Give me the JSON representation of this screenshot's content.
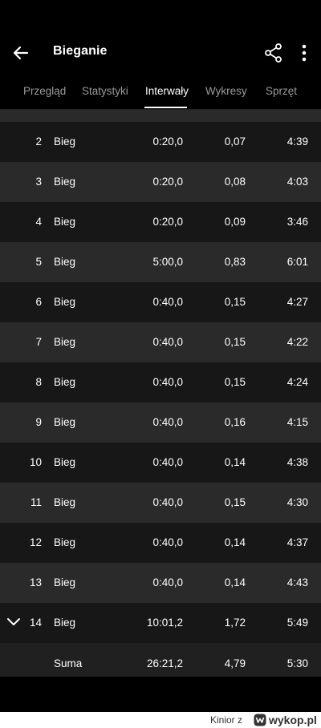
{
  "header": {
    "title": "Bieganie",
    "back_icon": "arrow-left-icon",
    "share_icon": "share-icon",
    "more_icon": "more-vertical-icon"
  },
  "tabs": [
    {
      "label": "Przegląd"
    },
    {
      "label": "Statystyki"
    },
    {
      "label": "Interwały",
      "active": true
    },
    {
      "label": "Wykresy"
    },
    {
      "label": "Sprzęt"
    }
  ],
  "rows": [
    {
      "num": "2",
      "type": "Bieg",
      "time": "0:20,0",
      "dist": "0,07",
      "pace": "4:39"
    },
    {
      "num": "3",
      "type": "Bieg",
      "time": "0:20,0",
      "dist": "0,08",
      "pace": "4:03"
    },
    {
      "num": "4",
      "type": "Bieg",
      "time": "0:20,0",
      "dist": "0,09",
      "pace": "3:46"
    },
    {
      "num": "5",
      "type": "Bieg",
      "time": "5:00,0",
      "dist": "0,83",
      "pace": "6:01"
    },
    {
      "num": "6",
      "type": "Bieg",
      "time": "0:40,0",
      "dist": "0,15",
      "pace": "4:27"
    },
    {
      "num": "7",
      "type": "Bieg",
      "time": "0:40,0",
      "dist": "0,15",
      "pace": "4:22"
    },
    {
      "num": "8",
      "type": "Bieg",
      "time": "0:40,0",
      "dist": "0,15",
      "pace": "4:24"
    },
    {
      "num": "9",
      "type": "Bieg",
      "time": "0:40,0",
      "dist": "0,16",
      "pace": "4:15"
    },
    {
      "num": "10",
      "type": "Bieg",
      "time": "0:40,0",
      "dist": "0,14",
      "pace": "4:38"
    },
    {
      "num": "11",
      "type": "Bieg",
      "time": "0:40,0",
      "dist": "0,15",
      "pace": "4:30"
    },
    {
      "num": "12",
      "type": "Bieg",
      "time": "0:40,0",
      "dist": "0,14",
      "pace": "4:37"
    },
    {
      "num": "13",
      "type": "Bieg",
      "time": "0:40,0",
      "dist": "0,14",
      "pace": "4:43"
    },
    {
      "num": "14",
      "type": "Bieg",
      "time": "10:01,2",
      "dist": "1,72",
      "pace": "5:49",
      "expand_icon": "chevron-down-icon"
    }
  ],
  "summary": {
    "label": "Suma",
    "time": "26:21,2",
    "dist": "4,79",
    "pace": "5:30"
  },
  "footer": {
    "user": "Kinior  z",
    "brand": "wykop.pl",
    "brand_icon": "wykop-logo-icon"
  },
  "colors": {
    "background": "#000000",
    "row_dark": "#171717",
    "row_light": "#2a2a2a",
    "tab_inactive": "#9a9a9a"
  }
}
